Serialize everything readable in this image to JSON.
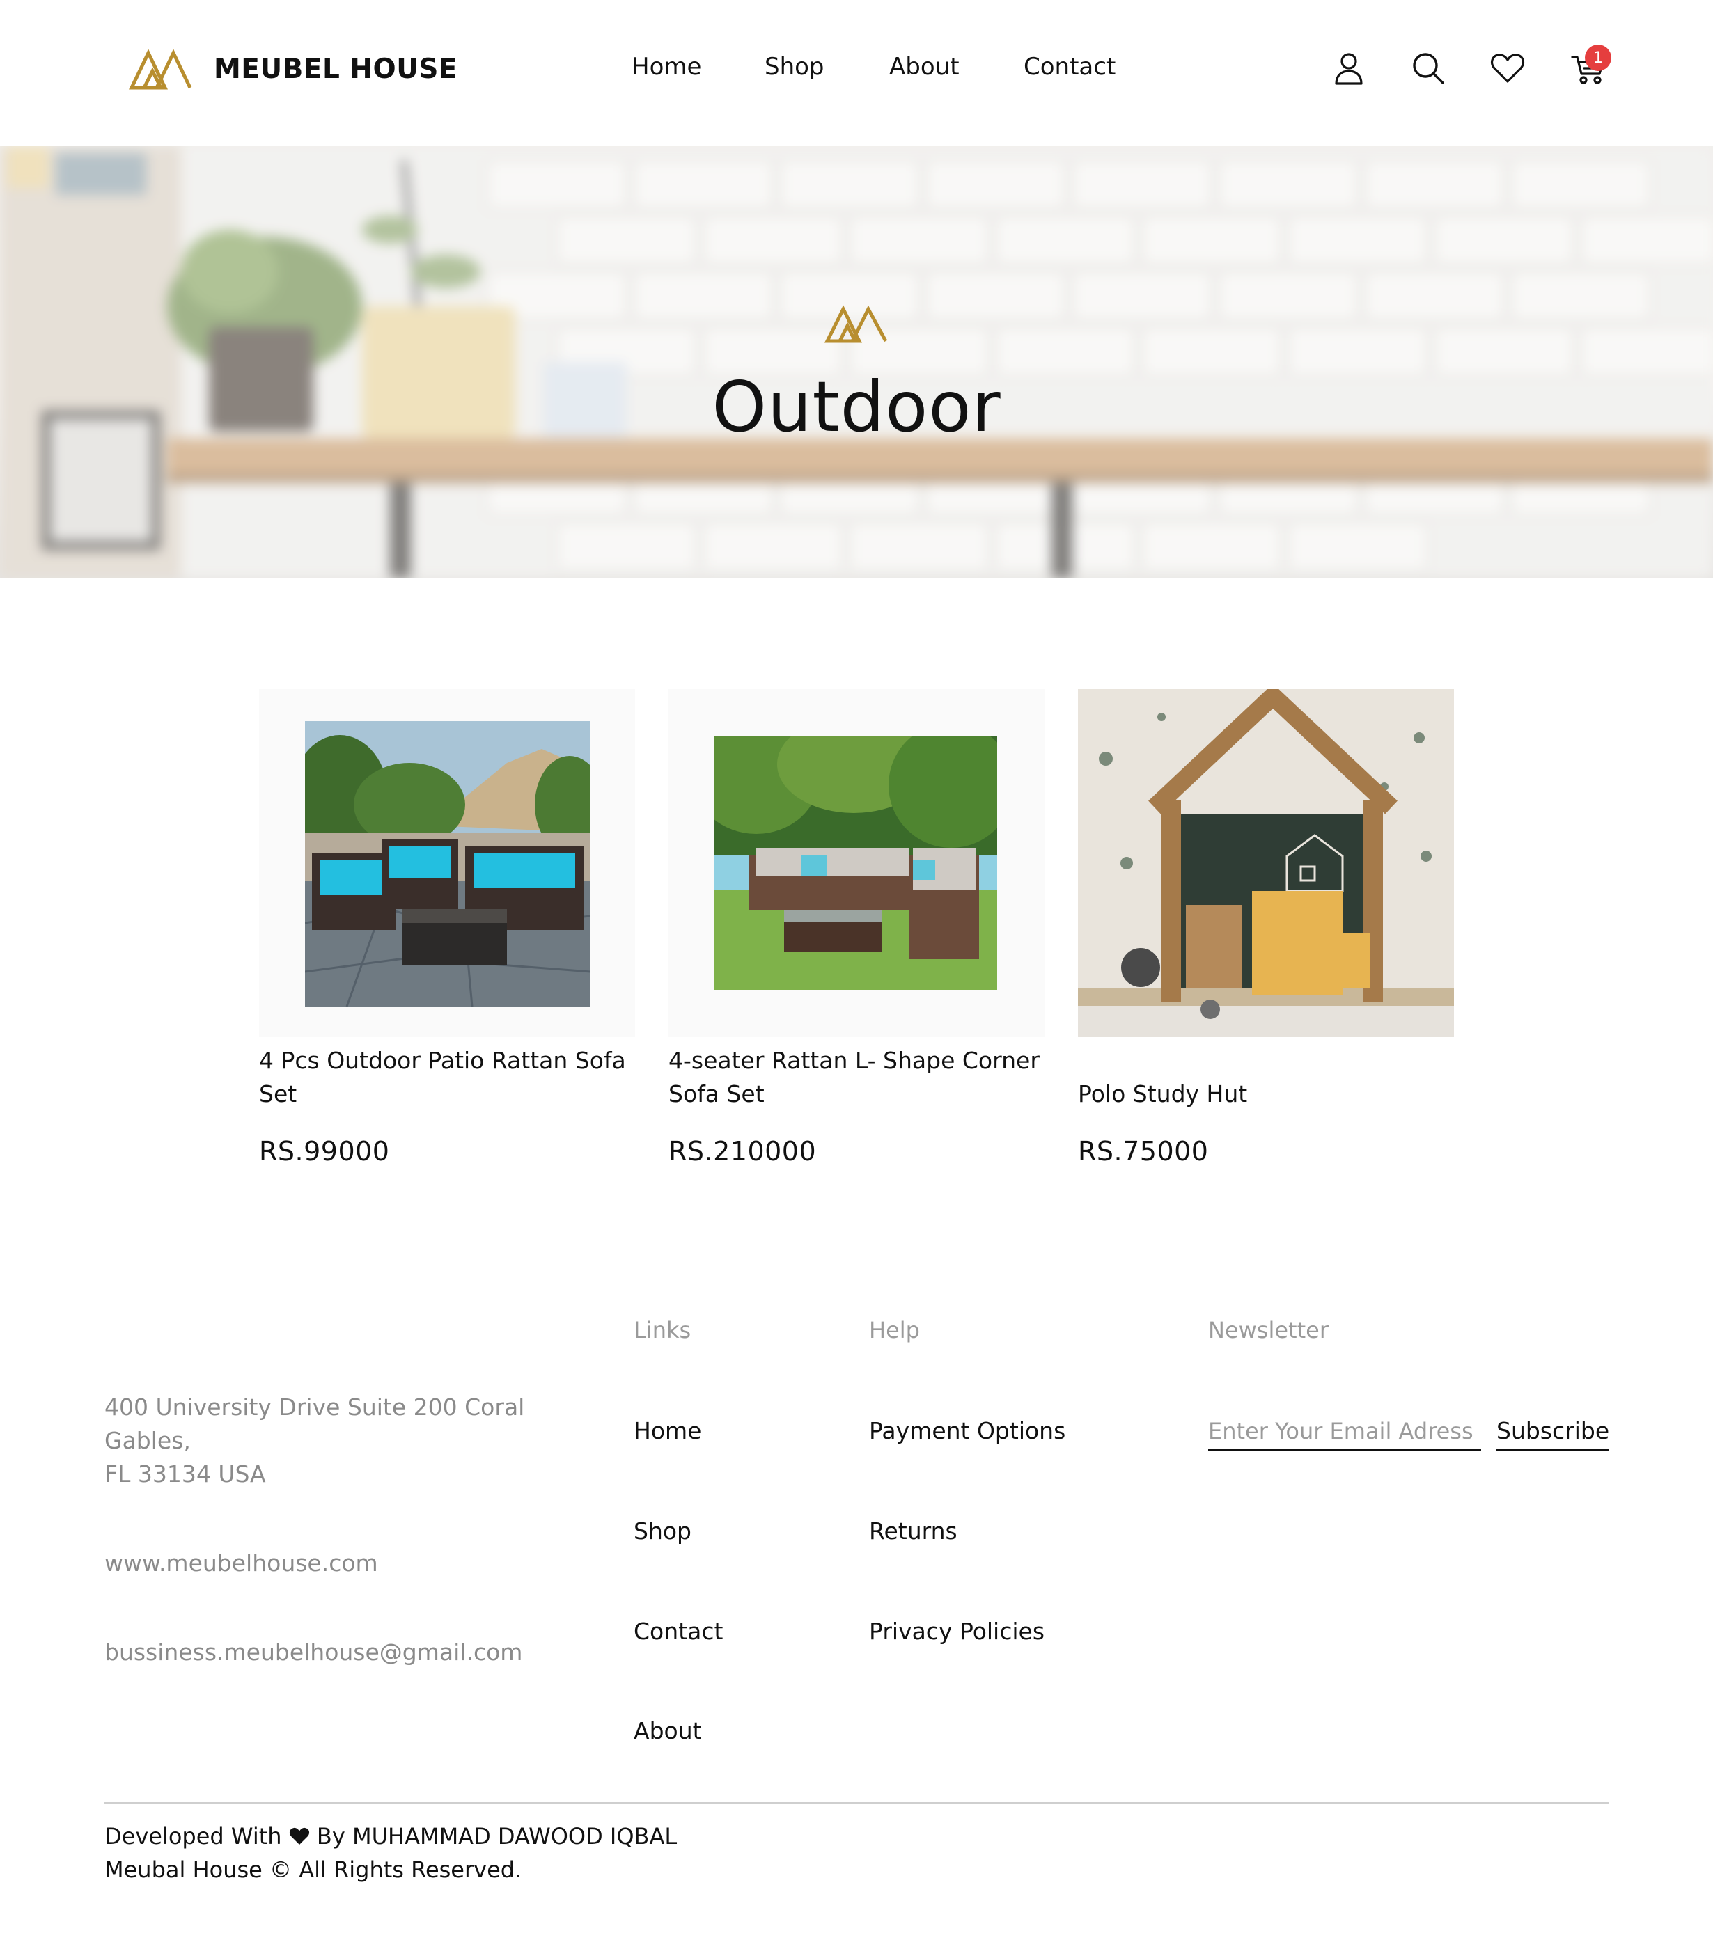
{
  "brand": {
    "name": "MEUBEL HOUSE",
    "logo_icon": "meubel-house-logo-icon",
    "accent_color": "#B88E2F"
  },
  "nav": {
    "home": "Home",
    "shop": "Shop",
    "about": "About",
    "contact": "Contact"
  },
  "header_icons": {
    "account": "user-icon",
    "search": "search-icon",
    "wishlist": "heart-icon",
    "cart": "cart-icon",
    "cart_count": "1",
    "badge_color": "#E53E3E"
  },
  "hero": {
    "title": "Outdoor"
  },
  "products": [
    {
      "name": "4 Pcs Outdoor Patio Rattan Sofa Set",
      "price": "RS.99000"
    },
    {
      "name": "4-seater Rattan L- Shape Corner Sofa Set",
      "price": "RS.210000"
    },
    {
      "name": "Polo Study Hut",
      "price": "RS.75000"
    }
  ],
  "footer": {
    "address_line1": "400 University Drive Suite 200 Coral Gables,",
    "address_line2": "FL 33134 USA",
    "website": "www.meubelhouse.com",
    "email": "bussiness.meubelhouse@gmail.com",
    "links_heading": "Links",
    "links": [
      "Home",
      "Shop",
      "Contact",
      "About"
    ],
    "help_heading": "Help",
    "help": [
      "Payment Options",
      "Returns",
      "Privacy Policies"
    ],
    "newsletter_heading": "Newsletter",
    "email_placeholder": "Enter Your Email Adress",
    "subscribe_label": "Subscribe",
    "credit_prefix": "Developed With",
    "credit_suffix": "By MUHAMMAD DAWOOD IQBAL",
    "copyright": "Meubal House © All Rights Reserved."
  }
}
